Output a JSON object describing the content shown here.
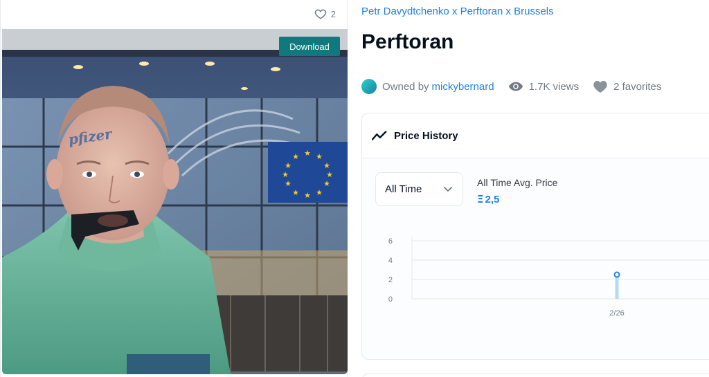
{
  "media": {
    "favorite_count": "2",
    "download_label": "Download",
    "image_subject": "man-with-taped-mouth-in-front-of-european-parliament",
    "forehead_text": "pfizer"
  },
  "asset": {
    "collection_name": "Petr Davydtchenko x Perftoran x Brussels",
    "title": "Perftoran",
    "owned_by_prefix": "Owned by",
    "owner_name": "mickybernard",
    "views": "1.7K views",
    "favorites": "2 favorites"
  },
  "price_history": {
    "title": "Price History",
    "range_selected": "All Time",
    "avg_label": "All Time Avg. Price",
    "avg_value": "2,5",
    "currency_symbol": "Ξ"
  },
  "chart_data": {
    "type": "line",
    "x": [
      "2/26"
    ],
    "series": [
      {
        "values": [
          2.5
        ]
      }
    ],
    "yticks": [
      0,
      2,
      4,
      6
    ],
    "ylim": [
      0,
      6
    ],
    "grid": true
  },
  "colors": {
    "accent_blue": "#2081e2",
    "download_teal": "#10797e",
    "muted_text": "#707a83",
    "border": "#e5e8eb"
  },
  "icons": {
    "heart": "heart-icon",
    "eye": "eye-icon",
    "trend": "trending-line-icon",
    "chevron": "chevron-down-icon"
  }
}
